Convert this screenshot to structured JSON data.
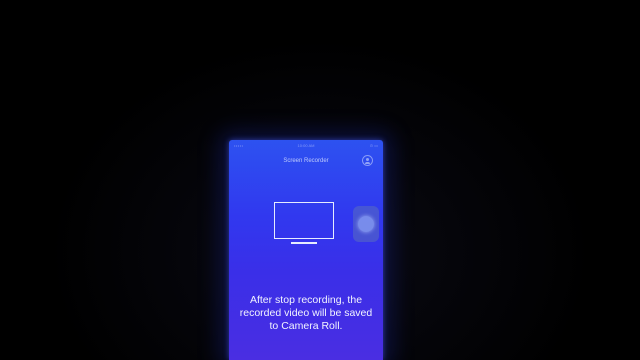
{
  "status_bar": {
    "carrier": "•••••",
    "time": "10:00 AM",
    "battery": "⊙ ▭"
  },
  "nav": {
    "title": "Screen Recorder"
  },
  "info_text": "After stop recording, the recorded video will be saved to Camera Roll.",
  "icons": {
    "settings": "profile-settings-icon",
    "display": "monitor-icon",
    "assistive_touch": "assistive-touch-icon"
  },
  "colors": {
    "screen_top": "#2d52f0",
    "screen_bottom": "#4a2ee2",
    "icon_stroke": "#e6ecff"
  }
}
